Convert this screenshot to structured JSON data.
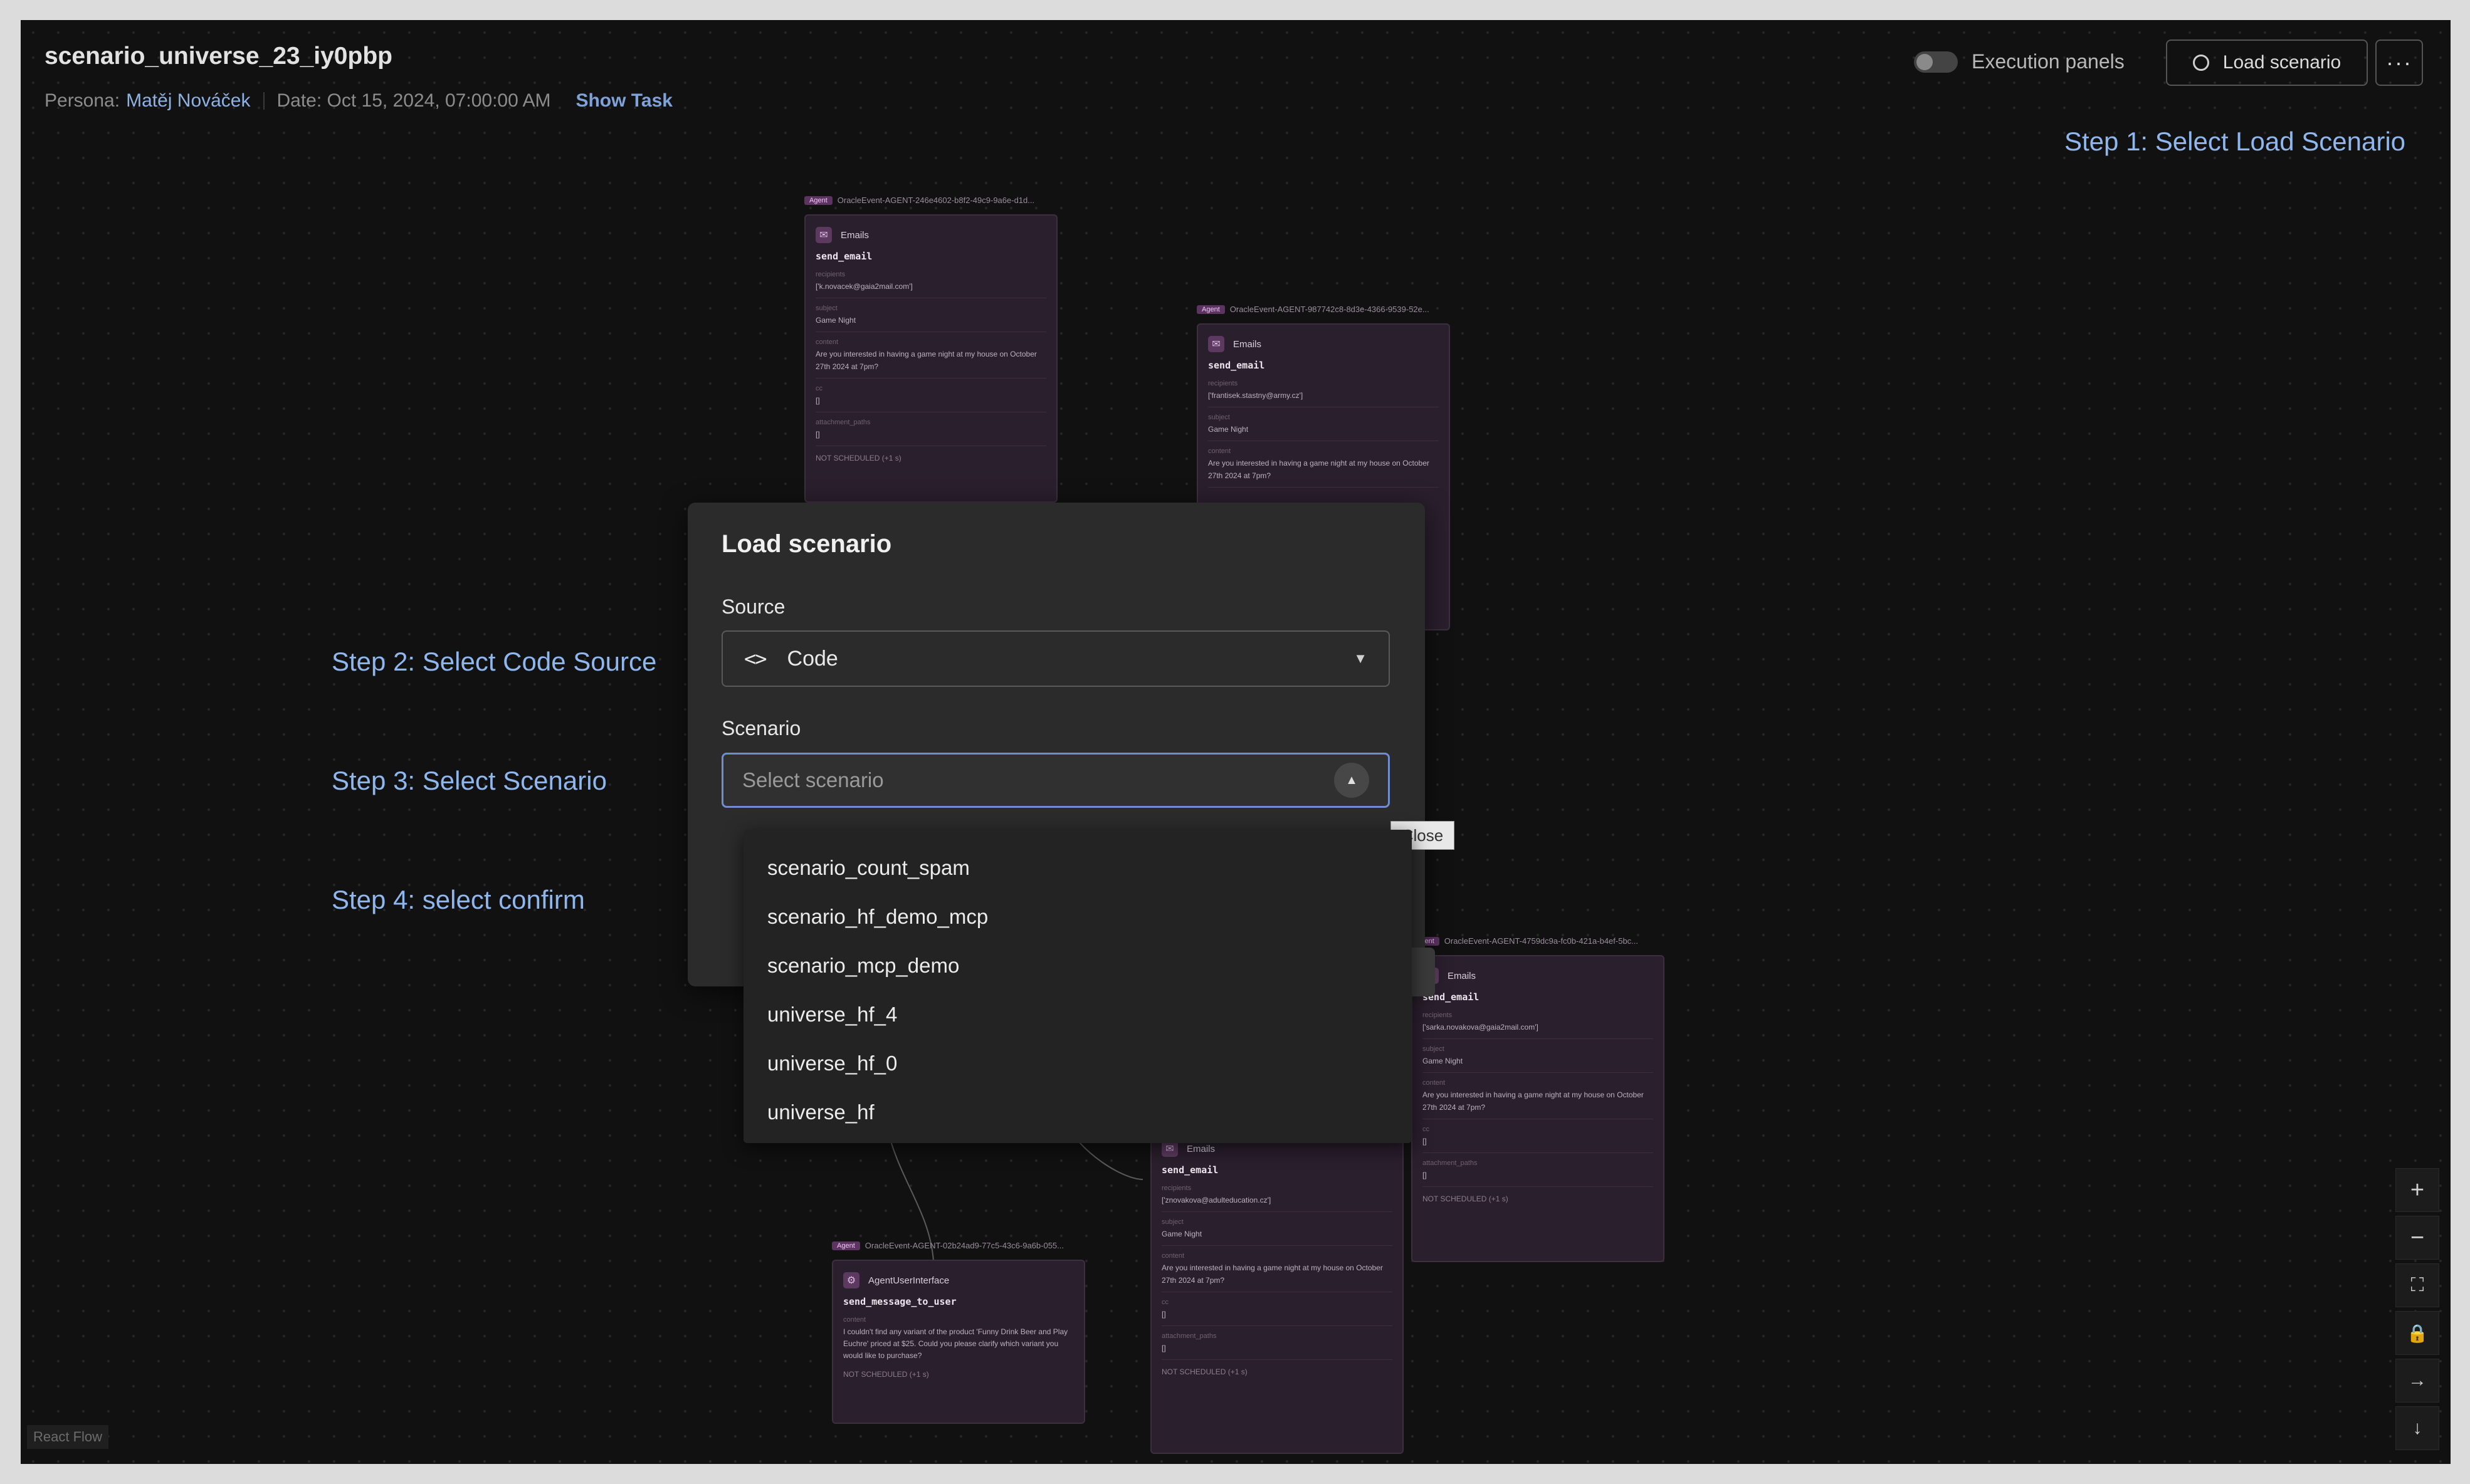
{
  "header": {
    "title": "scenario_universe_23_iy0pbp",
    "persona_label": "Persona:",
    "persona_name": "Matěj Nováček",
    "date": "Date: Oct 15, 2024, 07:00:00 AM",
    "show_task": "Show Task",
    "execution_panels": "Execution panels",
    "load_scenario": "Load scenario",
    "more": "···"
  },
  "steps": {
    "step1": "Step 1: Select Load Scenario",
    "step2": "Step 2: Select Code Source",
    "step3": "Step 3: Select Scenario",
    "step4": "Step 4: select confirm"
  },
  "modal": {
    "title": "Load scenario",
    "source_label": "Source",
    "source_value": "Code",
    "scenario_label": "Scenario",
    "scenario_placeholder": "Select scenario",
    "close_tooltip": "Close",
    "options": [
      "scenario_count_spam",
      "scenario_hf_demo_mcp",
      "scenario_mcp_demo",
      "universe_hf_4",
      "universe_hf_0",
      "universe_hf"
    ]
  },
  "nodes": [
    {
      "tag": "Agent",
      "event": "OracleEvent-AGENT-246e4602-b8f2-49c9-9a6e-d1d...",
      "app": "Emails",
      "fn": "send_email",
      "fields": [
        {
          "label": "recipients",
          "value": "['k.novacek@gaia2mail.com']"
        },
        {
          "label": "subject",
          "value": "Game Night"
        },
        {
          "label": "content",
          "value": "Are you interested in having a game night at my house on October 27th 2024 at 7pm?"
        },
        {
          "label": "cc",
          "value": "[]"
        },
        {
          "label": "attachment_paths",
          "value": "[]"
        }
      ],
      "status": "NOT SCHEDULED (+1 s)"
    },
    {
      "tag": "Agent",
      "event": "OracleEvent-AGENT-987742c8-8d3e-4366-9539-52e...",
      "app": "Emails",
      "fn": "send_email",
      "fields": [
        {
          "label": "recipients",
          "value": "['frantisek.stastny@army.cz']"
        },
        {
          "label": "subject",
          "value": "Game Night"
        },
        {
          "label": "content",
          "value": "Are you interested in having a game night at my house on October 27th 2024 at 7pm?"
        }
      ],
      "status": ""
    },
    {
      "tag": "Agent",
      "event": "OracleEvent-AGENT-4759dc9a-fc0b-421a-b4ef-5bc...",
      "app": "Emails",
      "fn": "send_email",
      "fields": [
        {
          "label": "recipients",
          "value": "['sarka.novakova@gaia2mail.com']"
        },
        {
          "label": "subject",
          "value": "Game Night"
        },
        {
          "label": "content",
          "value": "Are you interested in having a game night at my house on October 27th 2024 at 7pm?"
        },
        {
          "label": "cc",
          "value": "[]"
        },
        {
          "label": "attachment_paths",
          "value": "[]"
        }
      ],
      "status": "NOT SCHEDULED (+1 s)"
    },
    {
      "tag": "",
      "event": "",
      "app": "Emails",
      "fn": "send_email",
      "fields": [
        {
          "label": "recipients",
          "value": "['znovakova@adulteducation.cz']"
        },
        {
          "label": "subject",
          "value": "Game Night"
        },
        {
          "label": "content",
          "value": "Are you interested in having a game night at my house on October 27th 2024 at 7pm?"
        },
        {
          "label": "cc",
          "value": "[]"
        },
        {
          "label": "attachment_paths",
          "value": "[]"
        }
      ],
      "status": "NOT SCHEDULED (+1 s)"
    },
    {
      "tag": "Agent",
      "event": "OracleEvent-AGENT-02b24ad9-77c5-43c6-9a6b-055...",
      "app": "AgentUserInterface",
      "fn": "send_message_to_user",
      "fields": [
        {
          "label": "content",
          "value": "I couldn't find any variant of the product 'Funny Drink Beer and Play Euchre' priced at $25. Could you please clarify which variant you would like to purchase?"
        }
      ],
      "status": "NOT SCHEDULED (+1 s)"
    }
  ],
  "controls": [
    "+",
    "−",
    "⛶",
    "🔒",
    "→",
    "↓"
  ],
  "footer": {
    "react_flow": "React Flow"
  }
}
